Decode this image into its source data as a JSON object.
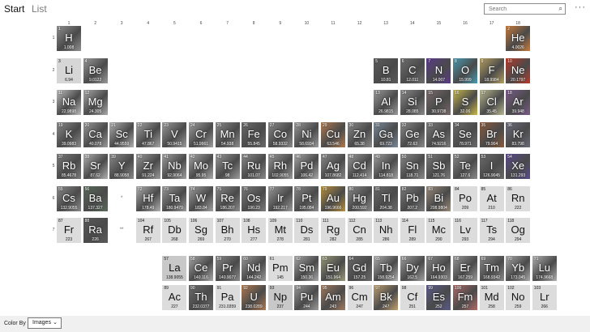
{
  "topbar": {
    "start_label": "Start",
    "list_label": "List",
    "search_placeholder": "Search",
    "search_icon": "search-icon",
    "more_label": "···"
  },
  "group_headers": [
    "1",
    "2",
    "3",
    "4",
    "5",
    "6",
    "7",
    "8",
    "9",
    "10",
    "11",
    "12",
    "13",
    "14",
    "15",
    "16",
    "17",
    "18"
  ],
  "period_headers": [
    "1",
    "2",
    "3",
    "4",
    "5",
    "6",
    "7"
  ],
  "series_markers": [
    "*",
    "**"
  ],
  "elements": [
    {
      "z": "1",
      "s": "H",
      "m": "1.008",
      "g": 1,
      "p": 1,
      "bg": "#8f8f8f"
    },
    {
      "z": "2",
      "s": "He",
      "m": "4.0026",
      "g": 18,
      "p": 1,
      "bg": "#c87a3a"
    },
    {
      "z": "3",
      "s": "Li",
      "m": "6.94",
      "g": 1,
      "p": 2,
      "bg": "#d6d6d6"
    },
    {
      "z": "4",
      "s": "Be",
      "m": "9.0122",
      "g": 2,
      "p": 2,
      "bg": "#9a9a9a"
    },
    {
      "z": "5",
      "s": "B",
      "m": "10.81",
      "g": 13,
      "p": 2,
      "bg": "#5a5a5a"
    },
    {
      "z": "6",
      "s": "C",
      "m": "12.011",
      "g": 14,
      "p": 2,
      "bg": "#6e6e6e"
    },
    {
      "z": "7",
      "s": "N",
      "m": "14.007",
      "g": 15,
      "p": 2,
      "bg": "#5a3a8a"
    },
    {
      "z": "8",
      "s": "O",
      "m": "15.999",
      "g": 16,
      "p": 2,
      "bg": "#4a9ab0"
    },
    {
      "z": "9",
      "s": "F",
      "m": "18.9984",
      "g": 17,
      "p": 2,
      "bg": "#b5a060"
    },
    {
      "z": "10",
      "s": "Ne",
      "m": "20.1797",
      "g": 18,
      "p": 2,
      "bg": "#b83a2a"
    },
    {
      "z": "11",
      "s": "Na",
      "m": "22.9898",
      "g": 1,
      "p": 3,
      "bg": "#bdbdbd"
    },
    {
      "z": "12",
      "s": "Mg",
      "m": "24.305",
      "g": 2,
      "p": 3,
      "bg": "#a8a8a8"
    },
    {
      "z": "13",
      "s": "Al",
      "m": "26.9815",
      "g": 13,
      "p": 3,
      "bg": "#9a9a9a"
    },
    {
      "z": "14",
      "s": "Si",
      "m": "28.085",
      "g": 14,
      "p": 3,
      "bg": "#8a8a8a"
    },
    {
      "z": "15",
      "s": "P",
      "m": "30.9738",
      "g": 15,
      "p": 3,
      "bg": "#7a6a6a"
    },
    {
      "z": "16",
      "s": "S",
      "m": "32.06",
      "g": 16,
      "p": 3,
      "bg": "#c8b84a"
    },
    {
      "z": "17",
      "s": "Cl",
      "m": "35.45",
      "g": 17,
      "p": 3,
      "bg": "#b8b890"
    },
    {
      "z": "18",
      "s": "Ar",
      "m": "39.948",
      "g": 18,
      "p": 3,
      "bg": "#7a5a8a"
    },
    {
      "z": "19",
      "s": "K",
      "m": "39.0983",
      "g": 1,
      "p": 4,
      "bg": "#8a8a8a"
    },
    {
      "z": "20",
      "s": "Ca",
      "m": "40.078",
      "g": 2,
      "p": 4,
      "bg": "#9a9a9a"
    },
    {
      "z": "21",
      "s": "Sc",
      "m": "44.9559",
      "g": 3,
      "p": 4,
      "bg": "#b0b0b0"
    },
    {
      "z": "22",
      "s": "Ti",
      "m": "47.867",
      "g": 4,
      "p": 4,
      "bg": "#a6a6a6"
    },
    {
      "z": "23",
      "s": "V",
      "m": "50.9415",
      "g": 5,
      "p": 4,
      "bg": "#9c9c9c"
    },
    {
      "z": "24",
      "s": "Cr",
      "m": "51.9961",
      "g": 6,
      "p": 4,
      "bg": "#a0a0a0"
    },
    {
      "z": "25",
      "s": "Mn",
      "m": "54.938",
      "g": 7,
      "p": 4,
      "bg": "#8c8c8c"
    },
    {
      "z": "26",
      "s": "Fe",
      "m": "55.845",
      "g": 8,
      "p": 4,
      "bg": "#6a6a6a"
    },
    {
      "z": "27",
      "s": "Co",
      "m": "58.9332",
      "g": 9,
      "p": 4,
      "bg": "#8a8a8a"
    },
    {
      "z": "28",
      "s": "Ni",
      "m": "58.6934",
      "g": 10,
      "p": 4,
      "bg": "#9a9a9a"
    },
    {
      "z": "29",
      "s": "Cu",
      "m": "63.546",
      "g": 11,
      "p": 4,
      "bg": "#b07a50"
    },
    {
      "z": "30",
      "s": "Zn",
      "m": "65.38",
      "g": 12,
      "p": 4,
      "bg": "#8a8a8a"
    },
    {
      "z": "31",
      "s": "Ga",
      "m": "69.723",
      "g": 13,
      "p": 4,
      "bg": "#7a8a9a"
    },
    {
      "z": "32",
      "s": "Ge",
      "m": "72.63",
      "g": 14,
      "p": 4,
      "bg": "#8a8a8a"
    },
    {
      "z": "33",
      "s": "As",
      "m": "74.9216",
      "g": 15,
      "p": 4,
      "bg": "#7a7a7a"
    },
    {
      "z": "34",
      "s": "Se",
      "m": "78.971",
      "g": 16,
      "p": 4,
      "bg": "#6a6a6a"
    },
    {
      "z": "35",
      "s": "Br",
      "m": "79.904",
      "g": 17,
      "p": 4,
      "bg": "#8a5a3a"
    },
    {
      "z": "36",
      "s": "Kr",
      "m": "83.798",
      "g": 18,
      "p": 4,
      "bg": "#6a6a7a"
    },
    {
      "z": "37",
      "s": "Rb",
      "m": "85.4678",
      "g": 1,
      "p": 5,
      "bg": "#7a7a7a"
    },
    {
      "z": "38",
      "s": "Sr",
      "m": "87.62",
      "g": 2,
      "p": 5,
      "bg": "#b0b0b0"
    },
    {
      "z": "39",
      "s": "Y",
      "m": "88.9058",
      "g": 3,
      "p": 5,
      "bg": "#8a8a8a"
    },
    {
      "z": "40",
      "s": "Zr",
      "m": "91.224",
      "g": 4,
      "p": 5,
      "bg": "#9a9a9a"
    },
    {
      "z": "41",
      "s": "Nb",
      "m": "92.9064",
      "g": 5,
      "p": 5,
      "bg": "#a0a0a0"
    },
    {
      "z": "42",
      "s": "Mo",
      "m": "95.95",
      "g": 6,
      "p": 5,
      "bg": "#a8a8a8"
    },
    {
      "z": "43",
      "s": "Tc",
      "m": "98",
      "g": 7,
      "p": 5,
      "bg": "#9a9a9a"
    },
    {
      "z": "44",
      "s": "Ru",
      "m": "101.07",
      "g": 8,
      "p": 5,
      "bg": "#8a8a8a"
    },
    {
      "z": "45",
      "s": "Rh",
      "m": "102.9055",
      "g": 9,
      "p": 5,
      "bg": "#9a9a9a"
    },
    {
      "z": "46",
      "s": "Pd",
      "m": "106.42",
      "g": 10,
      "p": 5,
      "bg": "#a8a8a8"
    },
    {
      "z": "47",
      "s": "Ag",
      "m": "107.8682",
      "g": 11,
      "p": 5,
      "bg": "#8a8a8a"
    },
    {
      "z": "48",
      "s": "Cd",
      "m": "112.414",
      "g": 12,
      "p": 5,
      "bg": "#9a9a9a"
    },
    {
      "z": "49",
      "s": "In",
      "m": "114.818",
      "g": 13,
      "p": 5,
      "bg": "#a0a0a0"
    },
    {
      "z": "50",
      "s": "Sn",
      "m": "118.71",
      "g": 14,
      "p": 5,
      "bg": "#8a8a8a"
    },
    {
      "z": "51",
      "s": "Sb",
      "m": "121.76",
      "g": 15,
      "p": 5,
      "bg": "#7a7a7a"
    },
    {
      "z": "52",
      "s": "Te",
      "m": "127.6",
      "g": 16,
      "p": 5,
      "bg": "#8a8a8a"
    },
    {
      "z": "53",
      "s": "I",
      "m": "126.9045",
      "g": 17,
      "p": 5,
      "bg": "#6a6a6a"
    },
    {
      "z": "54",
      "s": "Xe",
      "m": "131.293",
      "g": 18,
      "p": 5,
      "bg": "#5a4a8a"
    },
    {
      "z": "55",
      "s": "Cs",
      "m": "132.9055",
      "g": 1,
      "p": 6,
      "bg": "#8a8a8a"
    },
    {
      "z": "56",
      "s": "Ba",
      "m": "137.327",
      "g": 2,
      "p": 6,
      "bg": "#5a6a5a"
    },
    {
      "z": "72",
      "s": "Hf",
      "m": "178.49",
      "g": 4,
      "p": 6,
      "bg": "#b0b0b0"
    },
    {
      "z": "73",
      "s": "Ta",
      "m": "180.9479",
      "g": 5,
      "p": 6,
      "bg": "#9a9a9a"
    },
    {
      "z": "74",
      "s": "W",
      "m": "183.84",
      "g": 6,
      "p": 6,
      "bg": "#a0a0a0"
    },
    {
      "z": "75",
      "s": "Re",
      "m": "186.207",
      "g": 7,
      "p": 6,
      "bg": "#8a8a8a"
    },
    {
      "z": "76",
      "s": "Os",
      "m": "190.23",
      "g": 8,
      "p": 6,
      "bg": "#7a7a7a"
    },
    {
      "z": "77",
      "s": "Ir",
      "m": "192.217",
      "g": 9,
      "p": 6,
      "bg": "#9a9a9a"
    },
    {
      "z": "78",
      "s": "Pt",
      "m": "195.084",
      "g": 10,
      "p": 6,
      "bg": "#8a8a8a"
    },
    {
      "z": "79",
      "s": "Au",
      "m": "196.9666",
      "g": 11,
      "p": 6,
      "bg": "#b8903a"
    },
    {
      "z": "80",
      "s": "Hg",
      "m": "200.592",
      "g": 12,
      "p": 6,
      "bg": "#8a8a8a"
    },
    {
      "z": "81",
      "s": "Tl",
      "m": "204.38",
      "g": 13,
      "p": 6,
      "bg": "#6a6a6a"
    },
    {
      "z": "82",
      "s": "Pb",
      "m": "207.2",
      "g": 14,
      "p": 6,
      "bg": "#7a7a7a"
    },
    {
      "z": "83",
      "s": "Bi",
      "m": "208.9804",
      "g": 15,
      "p": 6,
      "bg": "#9a8a7a"
    },
    {
      "z": "84",
      "s": "Po",
      "m": "209",
      "g": 16,
      "p": 6,
      "bg": "#dcdcdc"
    },
    {
      "z": "85",
      "s": "At",
      "m": "210",
      "g": 17,
      "p": 6,
      "bg": "#dcdcdc"
    },
    {
      "z": "86",
      "s": "Rn",
      "m": "222",
      "g": 18,
      "p": 6,
      "bg": "#dcdcdc"
    },
    {
      "z": "87",
      "s": "Fr",
      "m": "223",
      "g": 1,
      "p": 7,
      "bg": "#dcdcdc"
    },
    {
      "z": "88",
      "s": "Ra",
      "m": "226",
      "g": 2,
      "p": 7,
      "bg": "#5a5a5a"
    },
    {
      "z": "104",
      "s": "Rf",
      "m": "267",
      "g": 4,
      "p": 7,
      "bg": "#dcdcdc"
    },
    {
      "z": "105",
      "s": "Db",
      "m": "268",
      "g": 5,
      "p": 7,
      "bg": "#dcdcdc"
    },
    {
      "z": "106",
      "s": "Sg",
      "m": "269",
      "g": 6,
      "p": 7,
      "bg": "#dcdcdc"
    },
    {
      "z": "107",
      "s": "Bh",
      "m": "270",
      "g": 7,
      "p": 7,
      "bg": "#dcdcdc"
    },
    {
      "z": "108",
      "s": "Hs",
      "m": "277",
      "g": 8,
      "p": 7,
      "bg": "#dcdcdc"
    },
    {
      "z": "109",
      "s": "Mt",
      "m": "278",
      "g": 9,
      "p": 7,
      "bg": "#dcdcdc"
    },
    {
      "z": "110",
      "s": "Ds",
      "m": "281",
      "g": 10,
      "p": 7,
      "bg": "#dcdcdc"
    },
    {
      "z": "111",
      "s": "Rg",
      "m": "282",
      "g": 11,
      "p": 7,
      "bg": "#dcdcdc"
    },
    {
      "z": "112",
      "s": "Cn",
      "m": "285",
      "g": 12,
      "p": 7,
      "bg": "#dcdcdc"
    },
    {
      "z": "113",
      "s": "Nh",
      "m": "286",
      "g": 13,
      "p": 7,
      "bg": "#dcdcdc"
    },
    {
      "z": "114",
      "s": "Fl",
      "m": "289",
      "g": 14,
      "p": 7,
      "bg": "#dcdcdc"
    },
    {
      "z": "115",
      "s": "Mc",
      "m": "290",
      "g": 15,
      "p": 7,
      "bg": "#dcdcdc"
    },
    {
      "z": "116",
      "s": "Lv",
      "m": "293",
      "g": 16,
      "p": 7,
      "bg": "#dcdcdc"
    },
    {
      "z": "117",
      "s": "Ts",
      "m": "294",
      "g": 17,
      "p": 7,
      "bg": "#dcdcdc"
    },
    {
      "z": "118",
      "s": "Og",
      "m": "294",
      "g": 18,
      "p": 7,
      "bg": "#dcdcdc"
    },
    {
      "z": "57",
      "s": "La",
      "m": "138.9055",
      "g": 5,
      "p": 9,
      "bg": "#c8c8c8"
    },
    {
      "z": "58",
      "s": "Ce",
      "m": "140.116",
      "g": 6,
      "p": 9,
      "bg": "#a8a8a8"
    },
    {
      "z": "59",
      "s": "Pr",
      "m": "140.9077",
      "g": 7,
      "p": 9,
      "bg": "#8a8a8a"
    },
    {
      "z": "60",
      "s": "Nd",
      "m": "144.242",
      "g": 8,
      "p": 9,
      "bg": "#9a9a9a"
    },
    {
      "z": "61",
      "s": "Pm",
      "m": "145",
      "g": 9,
      "p": 9,
      "bg": "#dcdcdc"
    },
    {
      "z": "62",
      "s": "Sm",
      "m": "150.36",
      "g": 10,
      "p": 9,
      "bg": "#a8a8a8"
    },
    {
      "z": "63",
      "s": "Eu",
      "m": "151.964",
      "g": 11,
      "p": 9,
      "bg": "#9a9a7a"
    },
    {
      "z": "64",
      "s": "Gd",
      "m": "157.25",
      "g": 12,
      "p": 9,
      "bg": "#6a6a6a"
    },
    {
      "z": "65",
      "s": "Tb",
      "m": "158.9254",
      "g": 13,
      "p": 9,
      "bg": "#b0b0b0"
    },
    {
      "z": "66",
      "s": "Dy",
      "m": "162.5",
      "g": 14,
      "p": 9,
      "bg": "#a0a0a0"
    },
    {
      "z": "67",
      "s": "Ho",
      "m": "164.9303",
      "g": 15,
      "p": 9,
      "bg": "#8a8a8a"
    },
    {
      "z": "68",
      "s": "Er",
      "m": "167.259",
      "g": 16,
      "p": 9,
      "bg": "#9a9a9a"
    },
    {
      "z": "69",
      "s": "Tm",
      "m": "168.9342",
      "g": 17,
      "p": 9,
      "bg": "#8a8a8a"
    },
    {
      "z": "70",
      "s": "Yb",
      "m": "173.045",
      "g": 18,
      "p": 9,
      "bg": "#a8a8a8"
    },
    {
      "z": "71",
      "s": "Lu",
      "m": "174.9668",
      "g": 19,
      "p": 9,
      "bg": "#b0b0b0"
    },
    {
      "z": "89",
      "s": "Ac",
      "m": "227",
      "g": 5,
      "p": 10,
      "bg": "#dcdcdc"
    },
    {
      "z": "90",
      "s": "Th",
      "m": "232.0377",
      "g": 6,
      "p": 10,
      "bg": "#6a6a6a"
    },
    {
      "z": "91",
      "s": "Pa",
      "m": "231.0359",
      "g": 7,
      "p": 10,
      "bg": "#dcdcdc"
    },
    {
      "z": "92",
      "s": "U",
      "m": "238.0289",
      "g": 8,
      "p": 10,
      "bg": "#b07a50"
    },
    {
      "z": "93",
      "s": "Np",
      "m": "237",
      "g": 9,
      "p": 10,
      "bg": "#c8c8c8"
    },
    {
      "z": "94",
      "s": "Pu",
      "m": "244",
      "g": 10,
      "p": 10,
      "bg": "#9a9a9a"
    },
    {
      "z": "95",
      "s": "Am",
      "m": "243",
      "g": 11,
      "p": 10,
      "bg": "#a07a60"
    },
    {
      "z": "96",
      "s": "Cm",
      "m": "247",
      "g": 12,
      "p": 10,
      "bg": "#dcdcdc"
    },
    {
      "z": "97",
      "s": "Bk",
      "m": "247",
      "g": 13,
      "p": 10,
      "bg": "#c0a070"
    },
    {
      "z": "98",
      "s": "Cf",
      "m": "251",
      "g": 14,
      "p": 10,
      "bg": "#dcdcdc"
    },
    {
      "z": "99",
      "s": "Es",
      "m": "252",
      "g": 15,
      "p": 10,
      "bg": "#5a5a8a"
    },
    {
      "z": "100",
      "s": "Fm",
      "m": "257",
      "g": 16,
      "p": 10,
      "bg": "#b06a6a"
    },
    {
      "z": "101",
      "s": "Md",
      "m": "258",
      "g": 17,
      "p": 10,
      "bg": "#dcdcdc"
    },
    {
      "z": "102",
      "s": "No",
      "m": "259",
      "g": 18,
      "p": 10,
      "bg": "#dcdcdc"
    },
    {
      "z": "103",
      "s": "Lr",
      "m": "266",
      "g": 19,
      "p": 10,
      "bg": "#dcdcdc"
    }
  ],
  "bottombar": {
    "colorby_label": "Color By",
    "colorby_value": "Images",
    "colorby_icon": "chevron-down-icon"
  }
}
